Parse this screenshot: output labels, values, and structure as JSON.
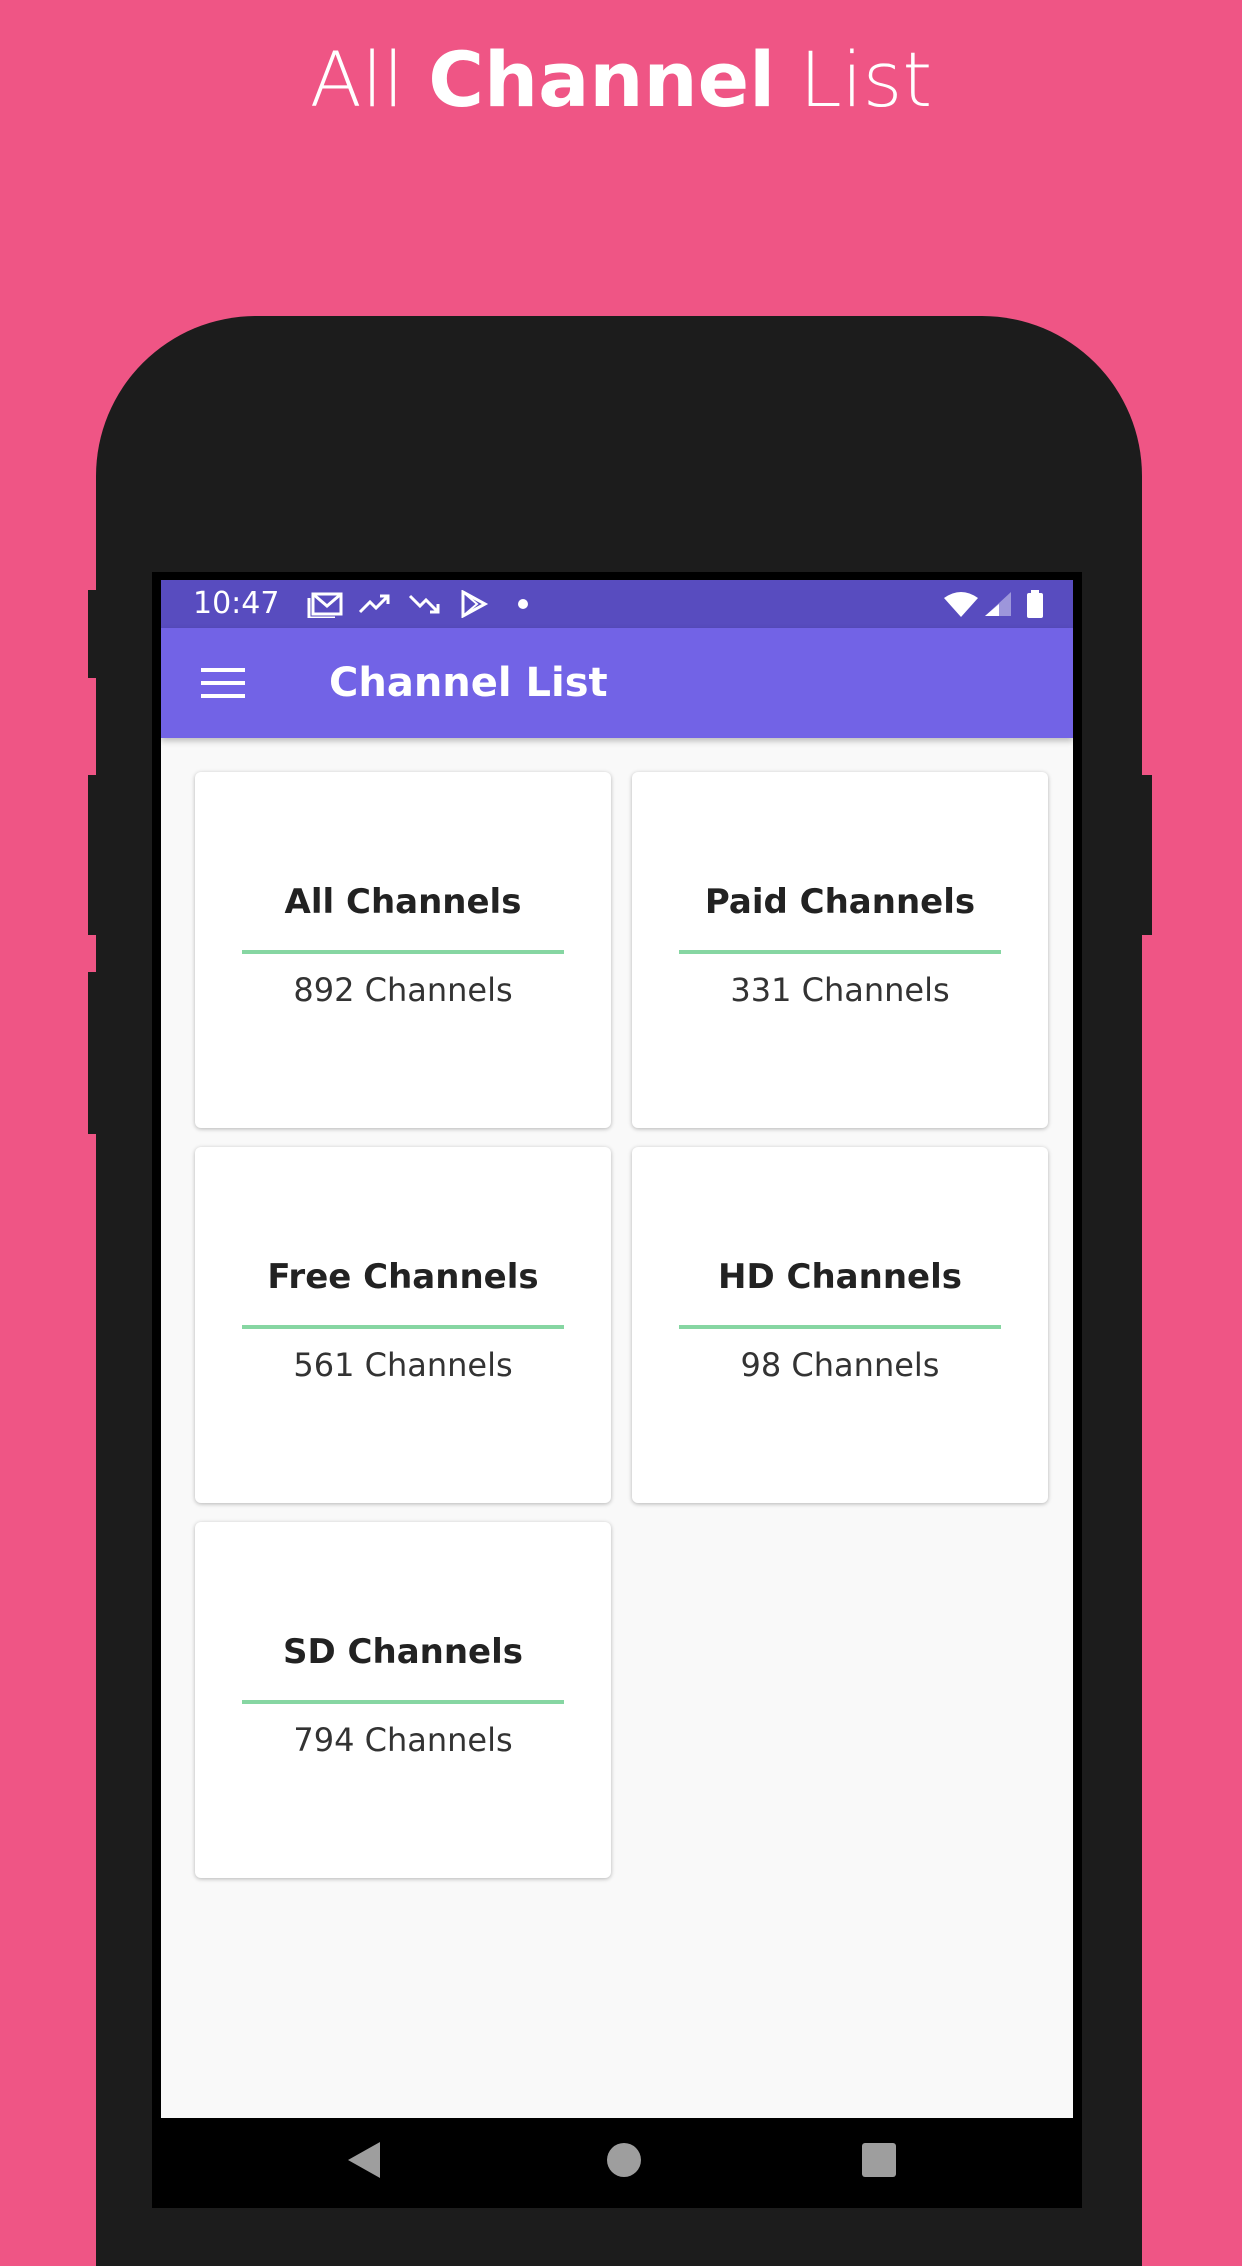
{
  "headline": {
    "light_1": "All",
    "bold": "Channel",
    "light_2": "List"
  },
  "status_bar": {
    "time": "10:47"
  },
  "app_bar": {
    "title": "Channel List"
  },
  "cards": [
    {
      "title": "All Channels",
      "count": "892 Channels"
    },
    {
      "title": "Paid Channels",
      "count": "331 Channels"
    },
    {
      "title": "Free Channels",
      "count": "561 Channels"
    },
    {
      "title": "HD Channels",
      "count": "98 Channels"
    },
    {
      "title": "SD Channels",
      "count": "794 Channels"
    }
  ],
  "colors": {
    "background": "#ef5585",
    "status_bar": "#584cbf",
    "app_bar": "#7263e6",
    "card_rule": "#86d6a2"
  },
  "icons": [
    "gmail-icon",
    "trending-up-icon",
    "trending-down-icon",
    "play-store-icon",
    "dot-icon",
    "wifi-icon",
    "signal-icon",
    "battery-icon",
    "menu-icon",
    "back-icon",
    "home-icon",
    "recents-icon"
  ]
}
